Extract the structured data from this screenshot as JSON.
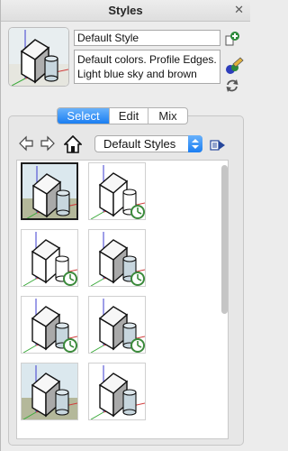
{
  "window": {
    "title": "Styles"
  },
  "style": {
    "name": "Default Style",
    "description": "Default colors. Profile Edges. Light blue sky and brown"
  },
  "tabs": [
    {
      "label": "Select",
      "active": true
    },
    {
      "label": "Edit",
      "active": false
    },
    {
      "label": "Mix",
      "active": false
    }
  ],
  "collection": {
    "selected": "Default Styles"
  },
  "icons": {
    "close": "close-icon",
    "add": "add-style-icon",
    "update": "update-style-icon",
    "refresh": "refresh-icon",
    "back": "back-arrow-icon",
    "forward": "forward-arrow-icon",
    "home": "home-icon",
    "details": "details-arrow-icon"
  },
  "thumbnails": [
    {
      "style": "sky-ground",
      "timer": false,
      "selected": true
    },
    {
      "style": "white-sketch",
      "timer": true,
      "selected": false
    },
    {
      "style": "white-sketch",
      "timer": true,
      "selected": false
    },
    {
      "style": "white-shaded",
      "timer": true,
      "selected": false
    },
    {
      "style": "white-shaded",
      "timer": true,
      "selected": false
    },
    {
      "style": "white-shaded",
      "timer": true,
      "selected": false
    },
    {
      "style": "sky-ground",
      "timer": false,
      "selected": false
    },
    {
      "style": "white-shaded",
      "timer": false,
      "selected": false
    }
  ],
  "colors": {
    "accent": "#1b7ef2",
    "sky": "#dbe8ee",
    "ground": "#b4b89a",
    "timer_green": "#3b8a3b"
  }
}
